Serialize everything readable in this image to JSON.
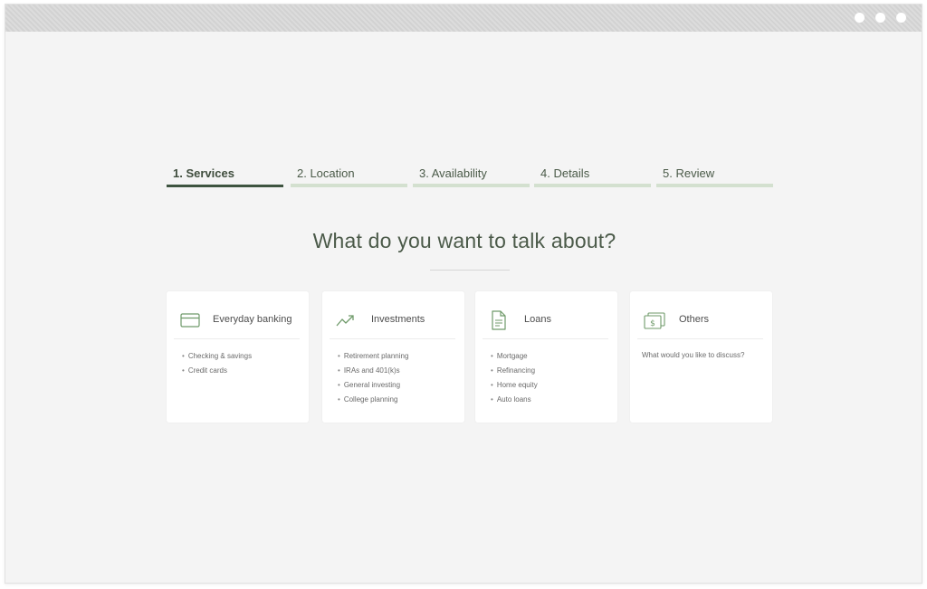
{
  "window": {
    "controls": [
      "dot",
      "dot",
      "dot"
    ]
  },
  "steps": [
    {
      "label": "1. Services",
      "active": true
    },
    {
      "label": "2. Location",
      "active": false
    },
    {
      "label": "3. Availability",
      "active": false
    },
    {
      "label": "4. Details",
      "active": false
    },
    {
      "label": "5. Review",
      "active": false
    }
  ],
  "heading": "What do you want to talk about?",
  "cards": [
    {
      "title": "Everyday banking",
      "icon": "credit-card-icon",
      "items": [
        "Checking & savings",
        "Credit cards"
      ]
    },
    {
      "title": "Investments",
      "icon": "trend-up-icon",
      "items": [
        "Retirement planning",
        "IRAs and 401(k)s",
        "General investing",
        "College planning"
      ]
    },
    {
      "title": "Loans",
      "icon": "document-icon",
      "items": [
        "Mortgage",
        "Refinancing",
        "Home equity",
        "Auto loans"
      ]
    },
    {
      "title": "Others",
      "icon": "money-icon",
      "prompt": "What would you like to discuss?"
    }
  ],
  "colors": {
    "accent": "#3e5440",
    "inactive_bar": "#d3e0cf",
    "icon": "#6f9a6a",
    "heading": "#4b5a49"
  }
}
